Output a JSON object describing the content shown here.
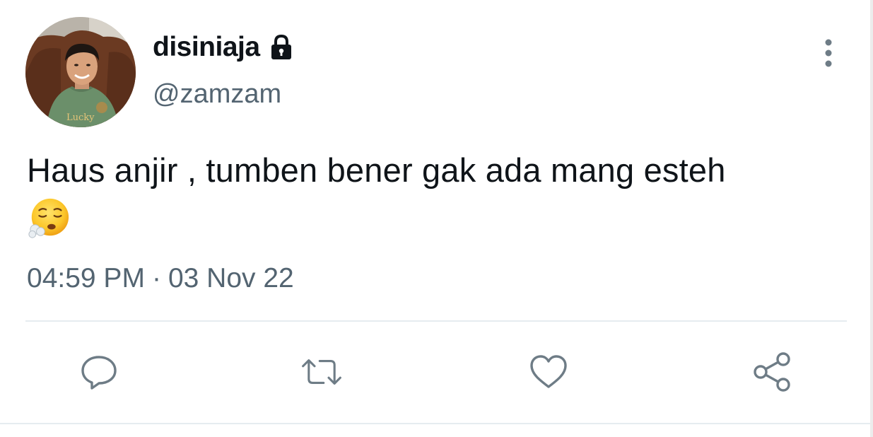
{
  "tweet": {
    "display_name": "disiniaja",
    "username": "@zamzam",
    "text": "Haus anjir , tumben bener gak ada mang esteh",
    "time": "04:59 PM",
    "separator": "·",
    "date": "03 Nov 22"
  },
  "icons": {
    "lock": "lock-icon",
    "more": "more-vertical-icon",
    "emoji": "face-exhaling-emoji",
    "reply": "reply-bubble-icon",
    "retweet": "retweet-icon",
    "like": "heart-icon",
    "share": "share-icon"
  },
  "avatar": {
    "shirt_text": "Lucky"
  },
  "colors": {
    "text_primary": "#0f1419",
    "text_secondary": "#536471",
    "icon_gray": "#6e7c86",
    "divider": "#e6ecf0"
  }
}
